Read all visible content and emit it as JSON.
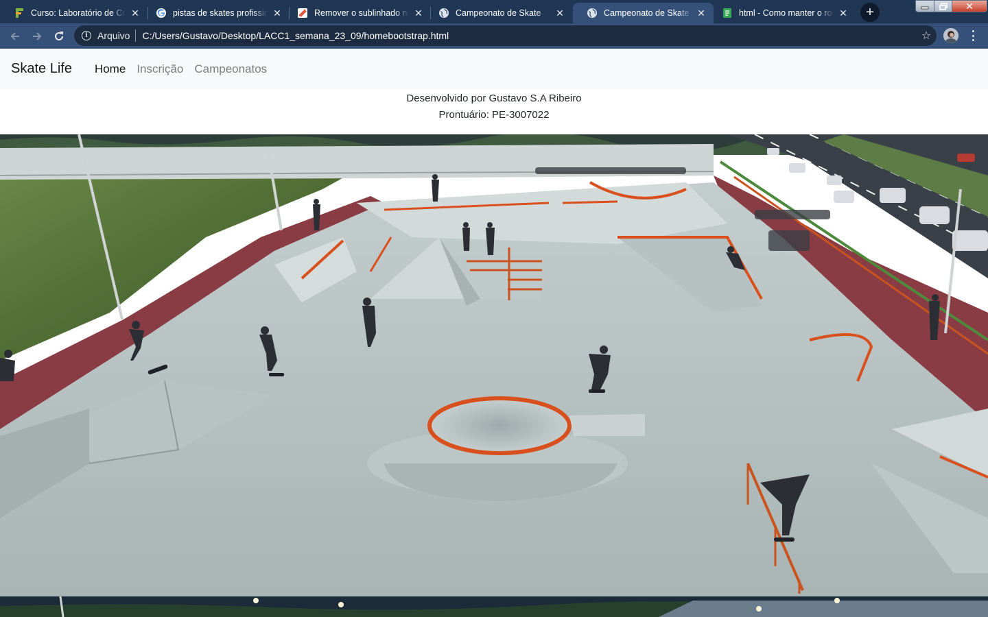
{
  "browser": {
    "tabs": [
      {
        "title": "Curso: Laboratório de Computação",
        "favicon": "green-course-icon",
        "active": false
      },
      {
        "title": "pistas de skates profissionais",
        "favicon": "google-icon",
        "active": false
      },
      {
        "title": "Remover o sublinhado nos links",
        "favicon": "stack-icon",
        "active": false
      },
      {
        "title": "Campeonato de Skate",
        "favicon": "globe-icon",
        "active": false
      },
      {
        "title": "Campeonato de Skate",
        "favicon": "globe-icon",
        "active": true
      },
      {
        "title": "html - Como manter o rodapé",
        "favicon": "green-sheet-icon",
        "active": false
      }
    ],
    "address": {
      "security_label": "Arquivo",
      "url": "C:/Users/Gustavo/Desktop/LACC1_semana_23_09/homebootstrap.html"
    },
    "colors": {
      "frame": "#1f3654",
      "toolbar": "#35517a",
      "omnibox": "#1d2c40"
    }
  },
  "navbar": {
    "brand": "Skate Life",
    "links": [
      {
        "label": "Home",
        "active": true
      },
      {
        "label": "Inscrição",
        "active": false
      },
      {
        "label": "Campeonatos",
        "active": false
      }
    ]
  },
  "credits": {
    "line1": "Desenvolvido por Gustavo S.A Ribeiro",
    "line2": "Prontuário: PE-3007022"
  },
  "colors": {
    "concrete": "#b9c4c4",
    "rail_orange": "#d8501e",
    "track_maroon": "#8a3c44",
    "grass": "#5a7a3a"
  }
}
